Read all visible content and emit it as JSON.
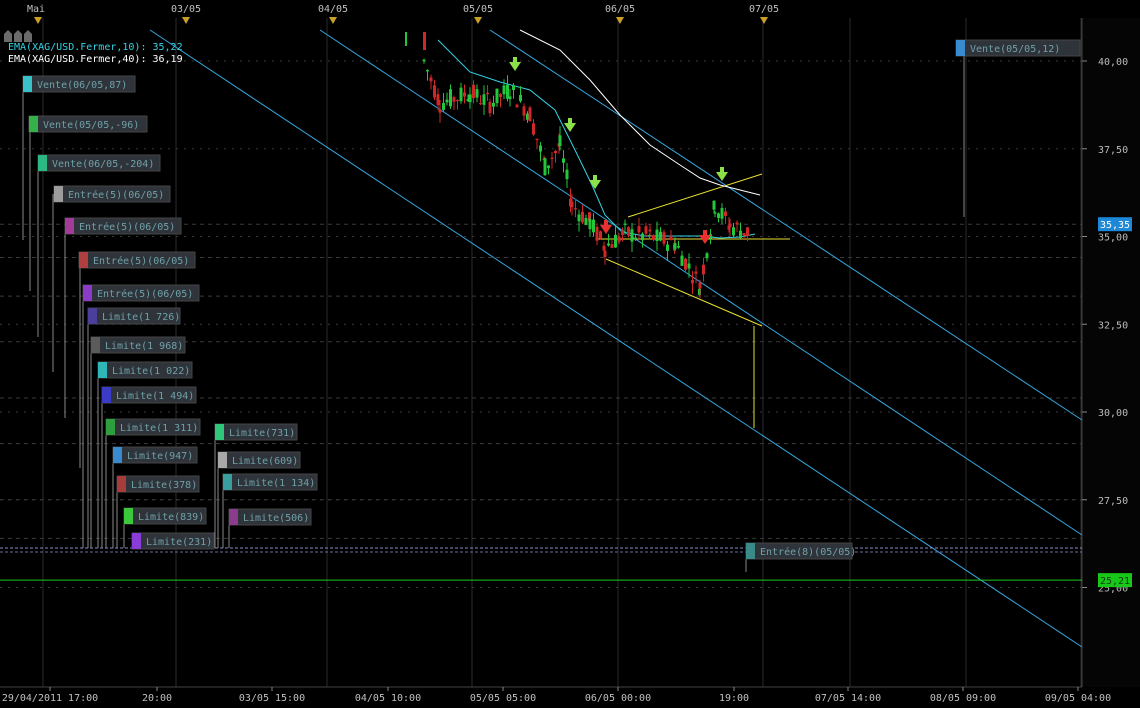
{
  "chart_data": {
    "type": "candlestick",
    "symbol": "XAG/USD",
    "y_axis": {
      "range": [
        23.4,
        41.0
      ],
      "ticks": [
        {
          "value": 40.0,
          "label": "40,00"
        },
        {
          "value": 37.5,
          "label": "37,50"
        },
        {
          "value": 35.0,
          "label": "35,00"
        },
        {
          "value": 32.5,
          "label": "32,50"
        },
        {
          "value": 30.0,
          "label": "30,00"
        },
        {
          "value": 27.5,
          "label": "27,50"
        },
        {
          "value": 25.0,
          "label": "25,00"
        }
      ]
    },
    "top_axis_labels": [
      "Mai",
      "03/05",
      "04/05",
      "05/05",
      "06/05",
      "07/05"
    ],
    "bottom_axis_labels": [
      "29/04/2011 17:00",
      "20:00",
      "03/05 15:00",
      "04/05 10:00",
      "05/05 05:00",
      "06/05 00:00",
      "19:00",
      "07/05 14:00",
      "08/05 09:00",
      "09/05 04:00"
    ],
    "indicators": [
      {
        "label": "EMA(XAG/USD.Fermer,10): 35,22",
        "color": "#35d3e6"
      },
      {
        "label": "EMA(XAG/USD.Fermer,40): 36,19",
        "color": "#ffffff"
      }
    ],
    "price_tags": [
      {
        "label": "35,35",
        "value": 35.35,
        "color": "#1e88d8"
      },
      {
        "label": "25,21",
        "value": 25.21,
        "color": "#18c818"
      }
    ],
    "orders": [
      {
        "label": "Vente(06/05,87)",
        "color": "#38c2c8"
      },
      {
        "label": "Vente(05/05,-96)",
        "color": "#35b04a"
      },
      {
        "label": "Vente(06/05,-204)",
        "color": "#2bb883"
      },
      {
        "label": "Entrée(5)(06/05)",
        "color": "#9c9c9c"
      },
      {
        "label": "Entrée(5)(06/05)",
        "color": "#a33b98"
      },
      {
        "label": "Entrée(5)(06/05)",
        "color": "#b04040"
      },
      {
        "label": "Entrée(5)(06/05)",
        "color": "#8a3cc8"
      },
      {
        "label": "Limite(1 726)",
        "color": "#4a3f9c"
      },
      {
        "label": "Limite(1 968)",
        "color": "#5b5b5b"
      },
      {
        "label": "Limite(1 022)",
        "color": "#2fb6b6"
      },
      {
        "label": "Limite(1 494)",
        "color": "#3b3bc8"
      },
      {
        "label": "Limite(1 311)",
        "color": "#2e9e3e"
      },
      {
        "label": "Limite(947)",
        "color": "#3a8ad0"
      },
      {
        "label": "Limite(378)",
        "color": "#a83c3c"
      },
      {
        "label": "Limite(839)",
        "color": "#3cc83c"
      },
      {
        "label": "Limite(231)",
        "color": "#8a3cd8"
      },
      {
        "label": "Limite(731)",
        "color": "#2fc87a"
      },
      {
        "label": "Limite(609)",
        "color": "#a8a8a8"
      },
      {
        "label": "Limite(1 134)",
        "color": "#3a9e9e"
      },
      {
        "label": "Limite(506)",
        "color": "#8c3c8c"
      },
      {
        "label": "Vente(05/05,12)",
        "color": "#3a8ad0"
      },
      {
        "label": "Entrée(8)(05/05)",
        "color": "#3a8a8a"
      }
    ]
  }
}
